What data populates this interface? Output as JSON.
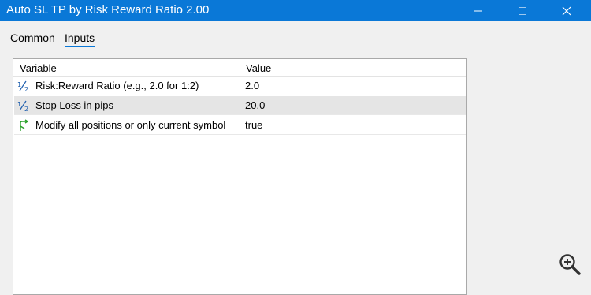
{
  "window": {
    "title": "Auto SL TP by Risk Reward Ratio 2.00",
    "accent": "#0a78d7"
  },
  "tabs": [
    {
      "label": "Common",
      "selected": false
    },
    {
      "label": "Inputs",
      "selected": true
    }
  ],
  "grid": {
    "columns": {
      "variable": "Variable",
      "value": "Value"
    },
    "rows": [
      {
        "icon": "fraction-icon",
        "variable": "Risk:Reward Ratio (e.g., 2.0 for 1:2)",
        "value": "2.0",
        "selected": false
      },
      {
        "icon": "fraction-icon",
        "variable": "Stop Loss in pips",
        "value": "20.0",
        "selected": true
      },
      {
        "icon": "branch-arrow-icon",
        "variable": "Modify all positions or only current symbol",
        "value": "true",
        "selected": false
      }
    ]
  },
  "icons": {
    "minimize": "minimize-icon",
    "maximize": "maximize-icon",
    "close": "close-icon",
    "zoom": "zoom-in-icon"
  }
}
